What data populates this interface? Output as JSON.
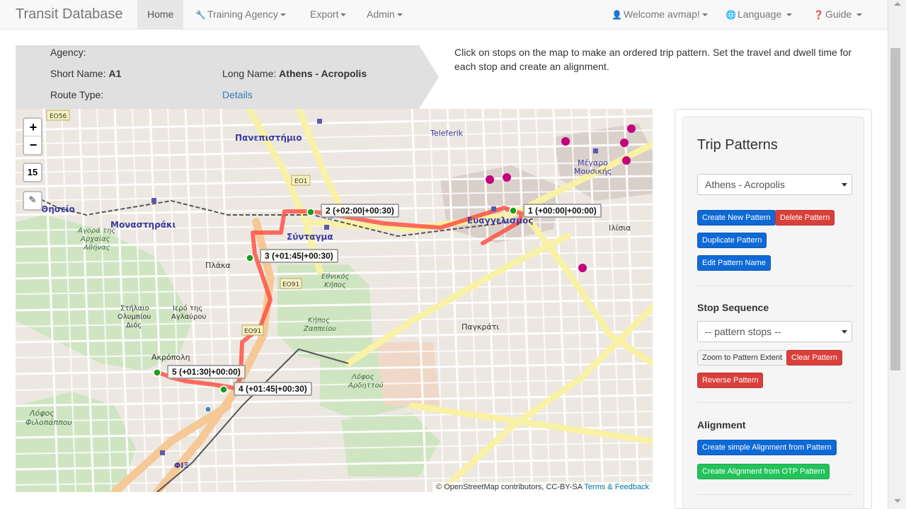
{
  "navbar": {
    "brand": "Transit Database",
    "items": [
      {
        "label": "Home",
        "active": true
      },
      {
        "label": "Training Agency",
        "icon": "wrench-icon"
      },
      {
        "label": "Export"
      },
      {
        "label": "Admin"
      }
    ],
    "right_items": [
      {
        "label": "Welcome avmap!",
        "icon": "user-icon"
      },
      {
        "label": "Language",
        "icon": "globe-icon"
      },
      {
        "label": "Guide",
        "icon": "question-circle-icon"
      }
    ]
  },
  "route": {
    "agency_label": "Agency:",
    "agency_value": "",
    "short_name_label": "Short Name:",
    "short_name_value": "A1",
    "long_name_label": "Long Name:",
    "long_name_value": "Athens - Acropolis",
    "route_type_label": "Route Type:",
    "details_link": "Details"
  },
  "instructions": "Click on stops on the map to make an ordered trip pattern. Set the travel and dwell time for each stop and create an alignment.",
  "map": {
    "zoom_in": "+",
    "zoom_out": "−",
    "zoom_level": "15",
    "stops": [
      {
        "label": "1 (+00:00|+00:00)"
      },
      {
        "label": "2 (+02:00|+00:30)"
      },
      {
        "label": "3 (+01:45|+00:30)"
      },
      {
        "label": "4 (+01:45|+00:30)"
      },
      {
        "label": "5 (+01:30|+00:00)"
      }
    ],
    "place_labels": [
      "Πανεπιστήμιο",
      "Σύνταγμα",
      "Ευαγγελισμός",
      "Μοναστηράκι",
      "Θησείο",
      "Μέγαρο Μουσικής",
      "Ακρόπολη",
      "Λόφος Φιλοπάππου",
      "Λόφος Αρδηττού",
      "Πλάκα",
      "Εθνικός Κήπος",
      "Κήπος Ζαππείου",
      "Παγκράτι",
      "Teleferik",
      "Ιλίσια",
      "Στήλαιο Ολυμπίου Διός",
      "Ιερό της Αγλαύρου",
      "Αγορά της Αρχαίας Αθήνας",
      "ΦΙΞ"
    ],
    "road_labels": [
      "EO56",
      "EO1",
      "EO91",
      "EO91"
    ],
    "attribution_text": "© OpenStreetMap contributors, CC-BY-SA",
    "attribution_link": "Terms & Feedback"
  },
  "panel": {
    "title": "Trip Patterns",
    "pattern_select_value": "Athens - Acropolis",
    "buttons": {
      "create_new": "Create New Pattern",
      "delete": "Delete Pattern",
      "duplicate": "Duplicate Pattern",
      "edit_name": "Edit Pattern Name"
    },
    "stop_sequence_title": "Stop Sequence",
    "stop_select_value": "-- pattern stops --",
    "stop_buttons": {
      "zoom": "Zoom to Pattern Extent",
      "clear": "Clear Pattern",
      "reverse": "Reverse Pattern"
    },
    "alignment_title": "Alignment",
    "alignment_buttons": {
      "simple": "Create simple Alignment from Pattern",
      "otp": "Create Alignment from OTP Pattern"
    }
  },
  "colors": {
    "route_line": "#ff5c4d",
    "stop_marker": "#1a9e1a",
    "primary": "#0d6ad6",
    "danger": "#d9403b",
    "success": "#22c35a"
  }
}
